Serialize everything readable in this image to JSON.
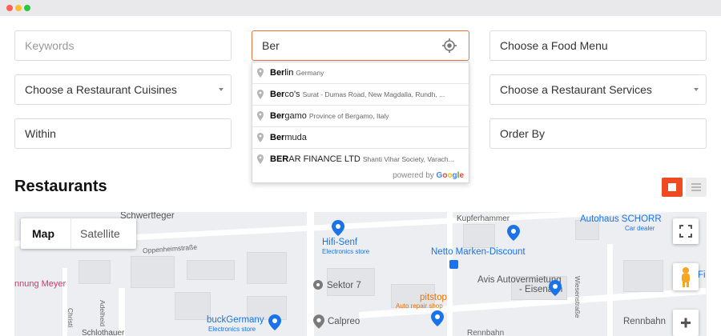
{
  "window": {
    "controls": [
      "close",
      "minimize",
      "maximize"
    ]
  },
  "filters": {
    "keywords_placeholder": "Keywords",
    "location_value": "Ber",
    "food_menu": "Choose a Food Menu",
    "cuisines": "Choose a Restaurant Cuisines",
    "services": "Choose a Restaurant Services",
    "within": "Within",
    "order_by": "Order By"
  },
  "autocomplete": {
    "items": [
      {
        "match": "Ber",
        "rest": "lin",
        "secondary": "Germany"
      },
      {
        "match": "Ber",
        "rest": "co's",
        "secondary": "Surat - Dumas Road, New Magdalla, Rundh, ..."
      },
      {
        "match": "Ber",
        "rest": "gamo",
        "secondary": "Province of Bergamo, Italy"
      },
      {
        "match": "Ber",
        "rest": "muda",
        "secondary": ""
      },
      {
        "match": "BER",
        "rest": "AR FINANCE LTD",
        "secondary": "Shanti Vihar Society, Varach..."
      }
    ],
    "powered_by": "powered by",
    "google": [
      "G",
      "o",
      "o",
      "g",
      "l",
      "e"
    ]
  },
  "section": {
    "title": "Restaurants"
  },
  "view_toggle": {
    "active": "grid",
    "accent": "#f04a23"
  },
  "map": {
    "type_options": {
      "map": "Map",
      "satellite": "Satellite"
    },
    "labels": {
      "schwertfeger": "Schwertfeger",
      "oppenheimstrasse": "Oppenheimstraße",
      "hifi_senf": "Hifi-Senf",
      "hifi_senf_sub": "Electronics store",
      "kupferhammer": "Kupferhammer",
      "autohaus": "Autohaus SCHORR",
      "autohaus_sub": "Car dealer",
      "netto": "Netto Marken-Discount",
      "meyer": "nnung Meyer",
      "sektor": "Sektor 7",
      "avis_line1": "Avis Autovermietung",
      "avis_line2": "- Eisenach",
      "wiesenstrasse": "Wiesenstraße",
      "pitstop": "pitstop",
      "pitstop_sub": "Auto repair shop",
      "buckgermany": "buckGermany",
      "buckgermany_sub": "Electronics store",
      "calpreo": "Calpreo",
      "rennbahn": "Rennbahn",
      "adelheid": "Adelheid",
      "christi": "Christi",
      "schlothauer": "Schlothauer",
      "rennbahn2": "Rennbahn",
      "fi": "Fi"
    },
    "colors": {
      "poi_blue": "#1a73e8",
      "poi_orange": "#e8710a",
      "poi_red": "#d6336c"
    }
  }
}
